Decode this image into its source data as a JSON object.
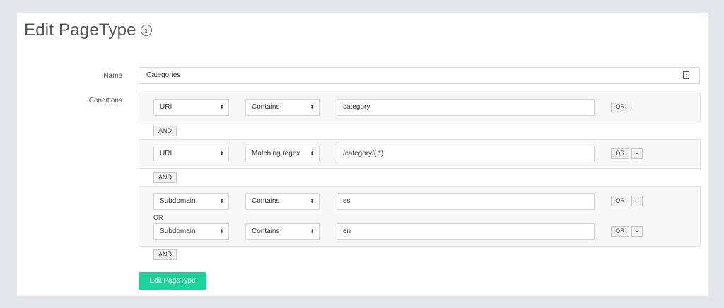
{
  "page": {
    "title": "Edit PageType",
    "info_icon_glyph": "i",
    "name_label": "Name",
    "conditions_label": "Conditions",
    "name_value": "Categories",
    "name_field_icon": "contact-card-icon",
    "submit_label": "Edit PageType"
  },
  "groups": [
    {
      "rows": [
        {
          "field": "URI",
          "operator": "Contains",
          "value": "category",
          "or_label": "OR",
          "show_minus": false
        }
      ]
    },
    {
      "rows": [
        {
          "field": "URI",
          "operator": "Matching regex",
          "value": "/category/(.*)",
          "or_label": "OR",
          "minus_label": "-",
          "show_minus": true
        }
      ]
    },
    {
      "separator_label": "OR",
      "rows": [
        {
          "field": "Subdomain",
          "operator": "Contains",
          "value": "es",
          "or_label": "OR",
          "minus_label": "-",
          "show_minus": true
        },
        {
          "field": "Subdomain",
          "operator": "Contains",
          "value": "en",
          "or_label": "OR",
          "minus_label": "-",
          "show_minus": true
        }
      ]
    }
  ],
  "and_label": "AND",
  "select_arrow_glyph": "⬍",
  "colors": {
    "background": "#e3e6ea",
    "card": "#ffffff",
    "primary": "#1ed39a",
    "group_bg": "#f7f7f7"
  }
}
